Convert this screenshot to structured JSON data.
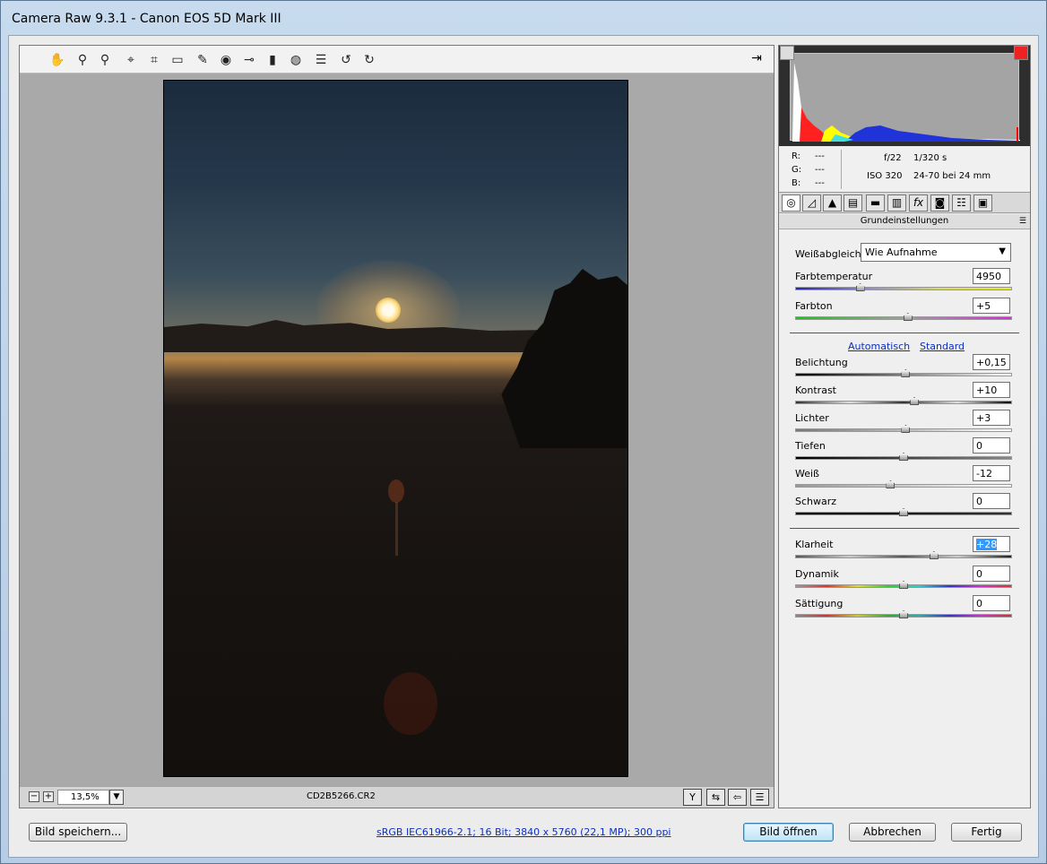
{
  "window": {
    "title": "Camera Raw 9.3.1 - Canon EOS 5D Mark III"
  },
  "toolbar": {
    "tools": [
      "✋",
      "⚲",
      "⚲",
      "⌖",
      "⌗",
      "▭",
      "✎",
      "◉",
      "⊸",
      "▮",
      "◍",
      "☰",
      "↺",
      "↻"
    ],
    "export_icon": "⇥"
  },
  "statusbar": {
    "minus": "−",
    "plus": "+",
    "zoom": "13,5%",
    "zoom_arrow": "▼",
    "filename": "CD2B5266.CR2",
    "icons": [
      "Y",
      "⇆",
      "⇦",
      "☰"
    ]
  },
  "info": {
    "r_label": "R:",
    "r_value": "---",
    "g_label": "G:",
    "g_value": "---",
    "b_label": "B:",
    "b_value": "---",
    "aperture": "f/22",
    "shutter": "1/320 s",
    "iso": "ISO 320",
    "lens": "24-70 bei 24 mm"
  },
  "tabs": [
    "◎",
    "◿",
    "▲",
    "▤",
    "▬",
    "▥",
    "fx",
    "◙",
    "☷",
    "▣"
  ],
  "section": {
    "title": "Grundeinstellungen",
    "menu": "☰"
  },
  "basic": {
    "wb_label": "Weißabgleich:",
    "wb_value": "Wie Aufnahme",
    "wb_arrow": "▼",
    "auto_link": "Automatisch",
    "default_link": "Standard",
    "sliders": [
      {
        "label": "Farbtemperatur",
        "value": "4950",
        "position": 0.3
      },
      {
        "label": "Farbton",
        "value": "+5",
        "position": 0.52
      },
      {
        "label": "Belichtung",
        "value": "+0,15",
        "position": 0.51
      },
      {
        "label": "Kontrast",
        "value": "+10",
        "position": 0.55
      },
      {
        "label": "Lichter",
        "value": "+3",
        "position": 0.51
      },
      {
        "label": "Tiefen",
        "value": "0",
        "position": 0.5
      },
      {
        "label": "Weiß",
        "value": "-12",
        "position": 0.44
      },
      {
        "label": "Schwarz",
        "value": "0",
        "position": 0.5
      },
      {
        "label": "Klarheit",
        "value": "+28",
        "position": 0.64
      },
      {
        "label": "Dynamik",
        "value": "0",
        "position": 0.5
      },
      {
        "label": "Sättigung",
        "value": "0",
        "position": 0.5
      }
    ]
  },
  "footer": {
    "save_button": "Bild speichern...",
    "workflow_link": "sRGB IEC61966-2.1; 16 Bit; 3840 x 5760 (22,1 MP); 300 ppi",
    "open_button": "Bild öffnen",
    "cancel_button": "Abbrechen",
    "done_button": "Fertig"
  }
}
